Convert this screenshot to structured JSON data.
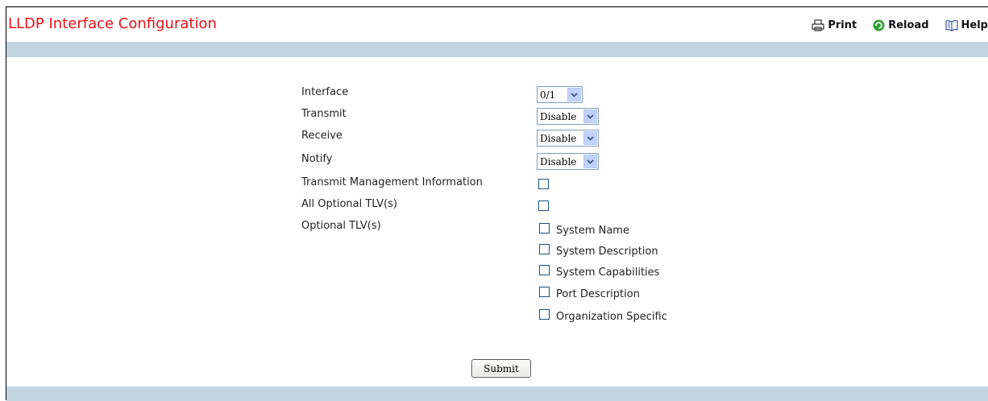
{
  "header": {
    "title": "LLDP Interface Configuration",
    "toolbar": {
      "print_label": "Print",
      "reload_label": "Reload",
      "help_label": "Help"
    }
  },
  "form": {
    "interface": {
      "label": "Interface",
      "value": "0/1"
    },
    "transmit": {
      "label": "Transmit",
      "value": "Disable"
    },
    "receive": {
      "label": "Receive",
      "value": "Disable"
    },
    "notify": {
      "label": "Notify",
      "value": "Disable"
    },
    "transmit_mgmt": {
      "label": "Transmit Management Information",
      "checked": false
    },
    "all_optional": {
      "label": "All Optional TLV(s)",
      "checked": false
    },
    "optional_tlvs": {
      "label": "Optional TLV(s)",
      "items": [
        {
          "label": "System Name",
          "checked": false
        },
        {
          "label": "System Description",
          "checked": false
        },
        {
          "label": "System Capabilities",
          "checked": false
        },
        {
          "label": "Port Description",
          "checked": false
        },
        {
          "label": "Organization Specific",
          "checked": false
        }
      ]
    },
    "submit_label": "Submit"
  },
  "colors": {
    "title": "#e8111b",
    "band": "#c3d4e1",
    "reload_icon": "#2e9e2e"
  }
}
